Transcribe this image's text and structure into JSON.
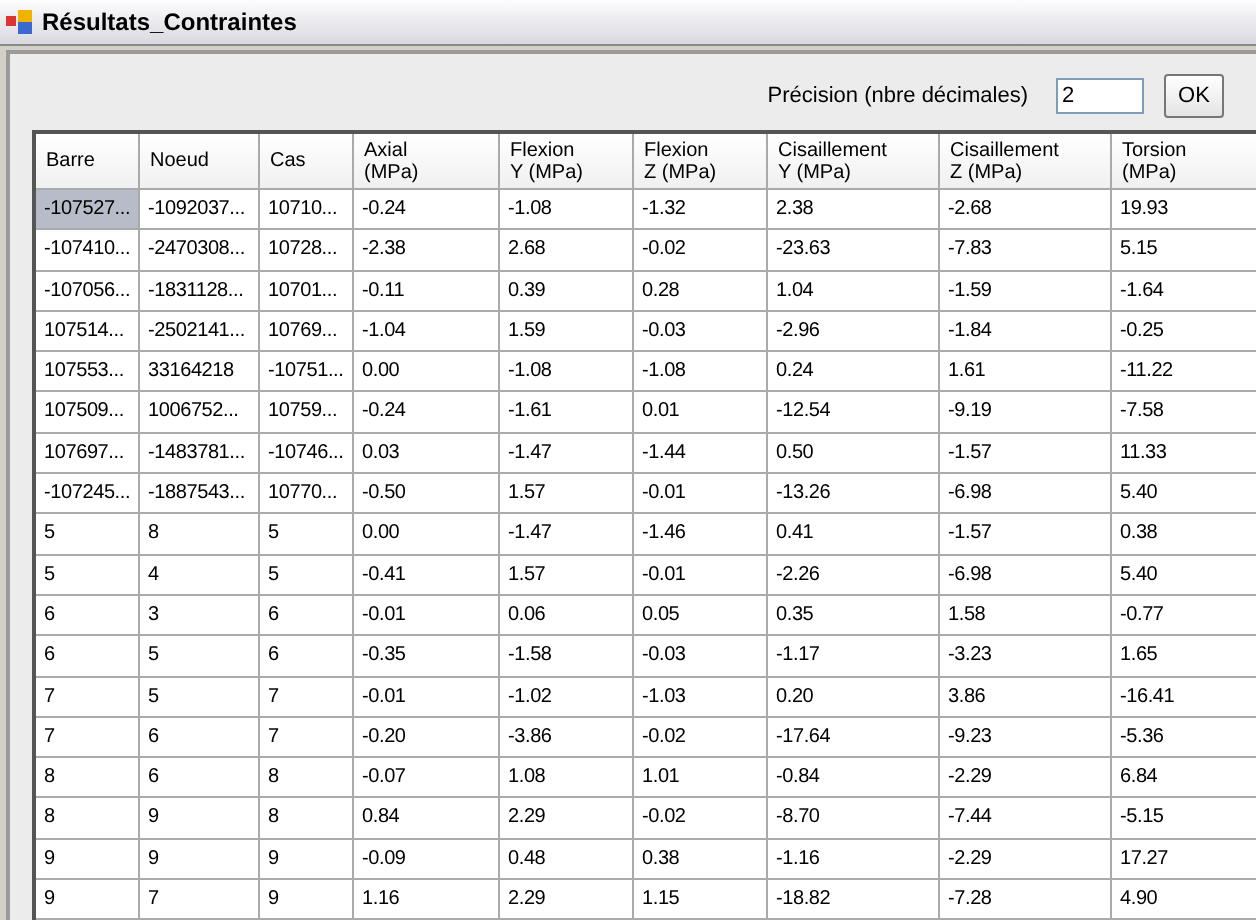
{
  "window": {
    "title": "Résultats_Contraintes"
  },
  "precision": {
    "label": "Précision (nbre décimales)",
    "value": "2"
  },
  "ok_button": "OK",
  "table": {
    "columns": [
      "Barre",
      "Noeud",
      "Cas",
      "Axial\n(MPa)",
      "Flexion\nY (MPa)",
      "Flexion\nZ (MPa)",
      "Cisaillement\nY (MPa)",
      "Cisaillement\nZ (MPa)",
      "Torsion\n(MPa)"
    ],
    "rows": [
      {
        "selected": true,
        "cells": [
          "-107527...",
          "-1092037...",
          "10710...",
          "-0.24",
          "-1.08",
          "-1.32",
          "2.38",
          "-2.68",
          "19.93"
        ]
      },
      {
        "selected": false,
        "cells": [
          "-107410...",
          "-2470308...",
          "10728...",
          "-2.38",
          "2.68",
          "-0.02",
          "-23.63",
          "-7.83",
          "5.15"
        ]
      },
      {
        "selected": false,
        "cells": [
          "-107056...",
          "-1831128...",
          "10701...",
          "-0.11",
          "0.39",
          "0.28",
          "1.04",
          "-1.59",
          "-1.64"
        ]
      },
      {
        "selected": false,
        "cells": [
          "107514...",
          "-2502141...",
          "10769...",
          "-1.04",
          "1.59",
          "-0.03",
          "-2.96",
          "-1.84",
          "-0.25"
        ]
      },
      {
        "selected": false,
        "cells": [
          "107553...",
          "33164218",
          "-10751...",
          "0.00",
          "-1.08",
          "-1.08",
          "0.24",
          "1.61",
          "-11.22"
        ]
      },
      {
        "selected": false,
        "cells": [
          "107509...",
          "1006752...",
          "10759...",
          "-0.24",
          "-1.61",
          "0.01",
          "-12.54",
          "-9.19",
          "-7.58"
        ]
      },
      {
        "selected": false,
        "cells": [
          "107697...",
          "-1483781...",
          "-10746...",
          "0.03",
          "-1.47",
          "-1.44",
          "0.50",
          "-1.57",
          "11.33"
        ]
      },
      {
        "selected": false,
        "cells": [
          "-107245...",
          "-1887543...",
          "10770...",
          "-0.50",
          "1.57",
          "-0.01",
          "-13.26",
          "-6.98",
          "5.40"
        ]
      },
      {
        "selected": false,
        "cells": [
          "5",
          "8",
          "5",
          "0.00",
          "-1.47",
          "-1.46",
          "0.41",
          "-1.57",
          "0.38"
        ]
      },
      {
        "selected": false,
        "cells": [
          "5",
          "4",
          "5",
          "-0.41",
          "1.57",
          "-0.01",
          "-2.26",
          "-6.98",
          "5.40"
        ]
      },
      {
        "selected": false,
        "cells": [
          "6",
          "3",
          "6",
          "-0.01",
          "0.06",
          "0.05",
          "0.35",
          "1.58",
          "-0.77"
        ]
      },
      {
        "selected": false,
        "cells": [
          "6",
          "5",
          "6",
          "-0.35",
          "-1.58",
          "-0.03",
          "-1.17",
          "-3.23",
          "1.65"
        ]
      },
      {
        "selected": false,
        "cells": [
          "7",
          "5",
          "7",
          "-0.01",
          "-1.02",
          "-1.03",
          "0.20",
          "3.86",
          "-16.41"
        ]
      },
      {
        "selected": false,
        "cells": [
          "7",
          "6",
          "7",
          "-0.20",
          "-3.86",
          "-0.02",
          "-17.64",
          "-9.23",
          "-5.36"
        ]
      },
      {
        "selected": false,
        "cells": [
          "8",
          "6",
          "8",
          "-0.07",
          "1.08",
          "1.01",
          "-0.84",
          "-2.29",
          "6.84"
        ]
      },
      {
        "selected": false,
        "cells": [
          "8",
          "9",
          "8",
          "0.84",
          "2.29",
          "-0.02",
          "-8.70",
          "-7.44",
          "-5.15"
        ]
      },
      {
        "selected": false,
        "cells": [
          "9",
          "9",
          "9",
          "-0.09",
          "0.48",
          "0.38",
          "-1.16",
          "-2.29",
          "17.27"
        ]
      },
      {
        "selected": false,
        "cells": [
          "9",
          "7",
          "9",
          "1.16",
          "2.29",
          "1.15",
          "-18.82",
          "-7.28",
          "4.90"
        ]
      }
    ]
  }
}
